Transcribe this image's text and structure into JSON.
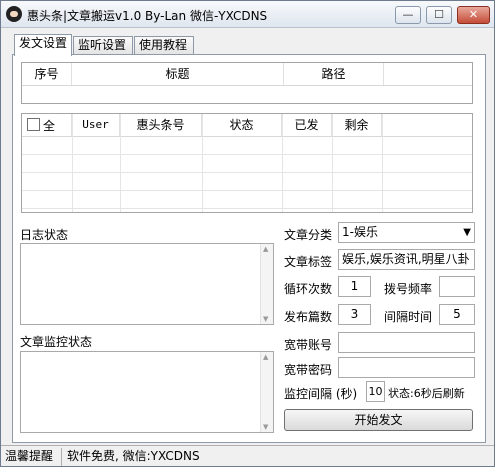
{
  "window": {
    "title": "惠头条|文章搬运v1.0 By-Lan 微信-YXCDNS",
    "controls": [
      "—",
      "☐",
      "✕"
    ]
  },
  "tabs": [
    {
      "label": "发文设置",
      "active": true
    },
    {
      "label": "监听设置",
      "active": false
    },
    {
      "label": "使用教程",
      "active": false
    }
  ],
  "article_table": {
    "columns": [
      "序号",
      "标题",
      "路径"
    ]
  },
  "account_table": {
    "select_all": "全",
    "columns": [
      "User",
      "惠头条号",
      "状态",
      "已发",
      "剩余"
    ]
  },
  "log": {
    "label": "日志状态"
  },
  "monitor": {
    "label": "文章监控状态"
  },
  "form": {
    "category_label": "文章分类",
    "category_value": "1-娱乐",
    "tags_label": "文章标签",
    "tags_value": "娱乐,娱乐资讯,明星八卦",
    "loop_label": "循环次数",
    "loop_value": "1",
    "dial_label": "拨号频率",
    "dial_value": "",
    "publish_label": "发布篇数",
    "publish_value": "3",
    "interval_label": "间隔时间",
    "interval_value": "5",
    "broadband_account_label": "宽带账号",
    "broadband_password_label": "宽带密码",
    "monitor_interval_label": "监控间隔 (秒)",
    "monitor_interval_value": "10",
    "monitor_status": "状态:6秒后刷新",
    "start_button": "开始发文"
  },
  "statusbar": {
    "left": "温馨提醒",
    "right": "软件免费, 微信:YXCDNS"
  }
}
